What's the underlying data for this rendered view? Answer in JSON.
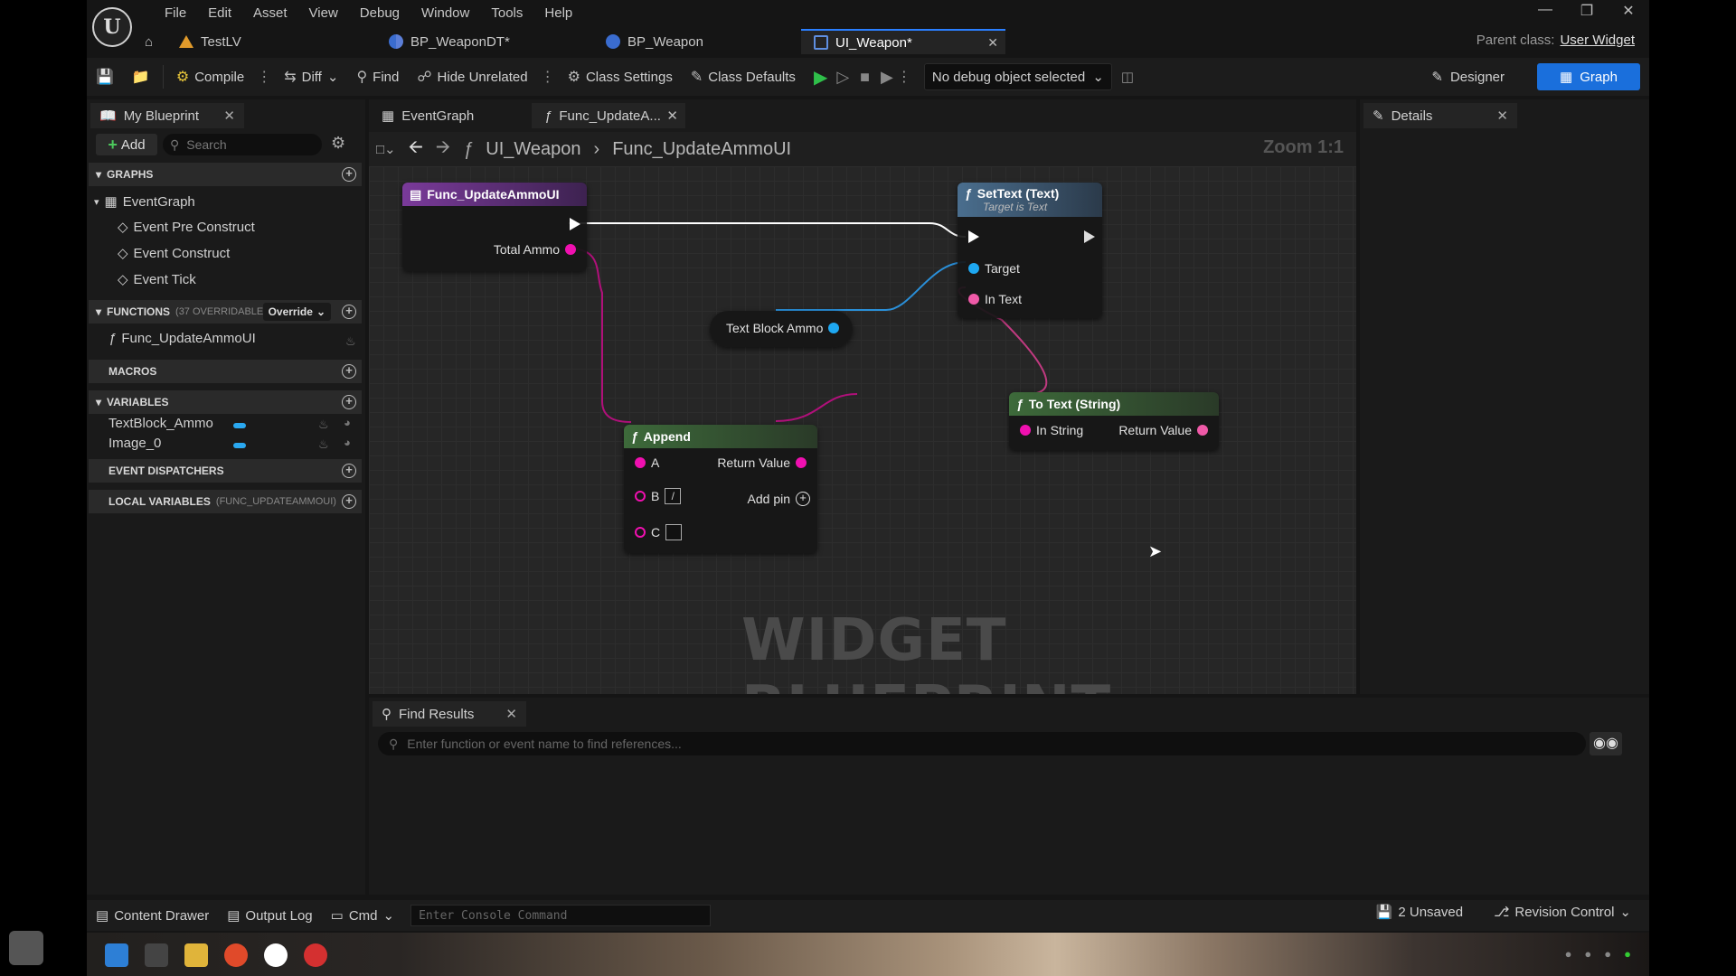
{
  "menu": [
    "File",
    "Edit",
    "Asset",
    "View",
    "Debug",
    "Window",
    "Tools",
    "Help"
  ],
  "tabs": [
    {
      "label": "TestLV"
    },
    {
      "label": "BP_WeaponDT*"
    },
    {
      "label": "BP_Weapon"
    },
    {
      "label": "UI_Weapon*"
    }
  ],
  "parent_class": {
    "label": "Parent class:",
    "value": "User Widget"
  },
  "toolbar": {
    "compile": "Compile",
    "diff": "Diff",
    "find": "Find",
    "hide_unrelated": "Hide Unrelated",
    "class_settings": "Class Settings",
    "class_defaults": "Class Defaults",
    "debug_object": "No debug object selected",
    "designer": "Designer",
    "graph": "Graph"
  },
  "my_blueprint": {
    "title": "My Blueprint",
    "add": "Add",
    "search_placeholder": "Search",
    "sections": {
      "graphs": "GRAPHS",
      "functions": "FUNCTIONS",
      "functions_sub": "(37 OVERRIDABLE",
      "override": "Override",
      "macros": "MACROS",
      "variables": "VARIABLES",
      "event_dispatchers": "EVENT DISPATCHERS",
      "local_variables": "LOCAL VARIABLES",
      "local_variables_sub": "(FUNC_UPDATEAMMOUI)"
    },
    "event_graph": "EventGraph",
    "events": [
      "Event Pre Construct",
      "Event Construct",
      "Event Tick"
    ],
    "functions": [
      "Func_UpdateAmmoUI"
    ],
    "variables": [
      "TextBlock_Ammo",
      "Image_0"
    ]
  },
  "graph_tabs": [
    "EventGraph",
    "Func_UpdateA..."
  ],
  "breadcrumb": {
    "root": "UI_Weapon",
    "current": "Func_UpdateAmmoUI",
    "zoom": "Zoom 1:1"
  },
  "nodes": {
    "entry": {
      "title": "Func_UpdateAmmoUI",
      "pin_total_ammo": "Total Ammo"
    },
    "settext": {
      "title": "SetText (Text)",
      "subtitle": "Target is Text",
      "pin_target": "Target",
      "pin_in_text": "In Text"
    },
    "textblock": {
      "label": "Text Block Ammo"
    },
    "totext": {
      "title": "To Text (String)",
      "pin_in": "In String",
      "pin_out": "Return Value"
    },
    "append": {
      "title": "Append",
      "pin_a": "A",
      "pin_b": "B",
      "pin_b_value": "/",
      "pin_c": "C",
      "pin_out": "Return Value",
      "add_pin": "Add pin"
    }
  },
  "watermark": "WIDGET BLUEPRINT",
  "details": {
    "title": "Details"
  },
  "find_results": {
    "title": "Find Results",
    "placeholder": "Enter function or event name to find references..."
  },
  "statusbar": {
    "content_drawer": "Content Drawer",
    "output_log": "Output Log",
    "cmd": "Cmd",
    "console_placeholder": "Enter Console Command",
    "unsaved": "2 Unsaved",
    "revision_control": "Revision Control"
  },
  "colors": {
    "accent": "#1a6fdc",
    "exec": "#ffffff",
    "string_pin": "#f010b0",
    "object_pin": "#1ea8f2",
    "text_pin": "#f05aa8"
  }
}
